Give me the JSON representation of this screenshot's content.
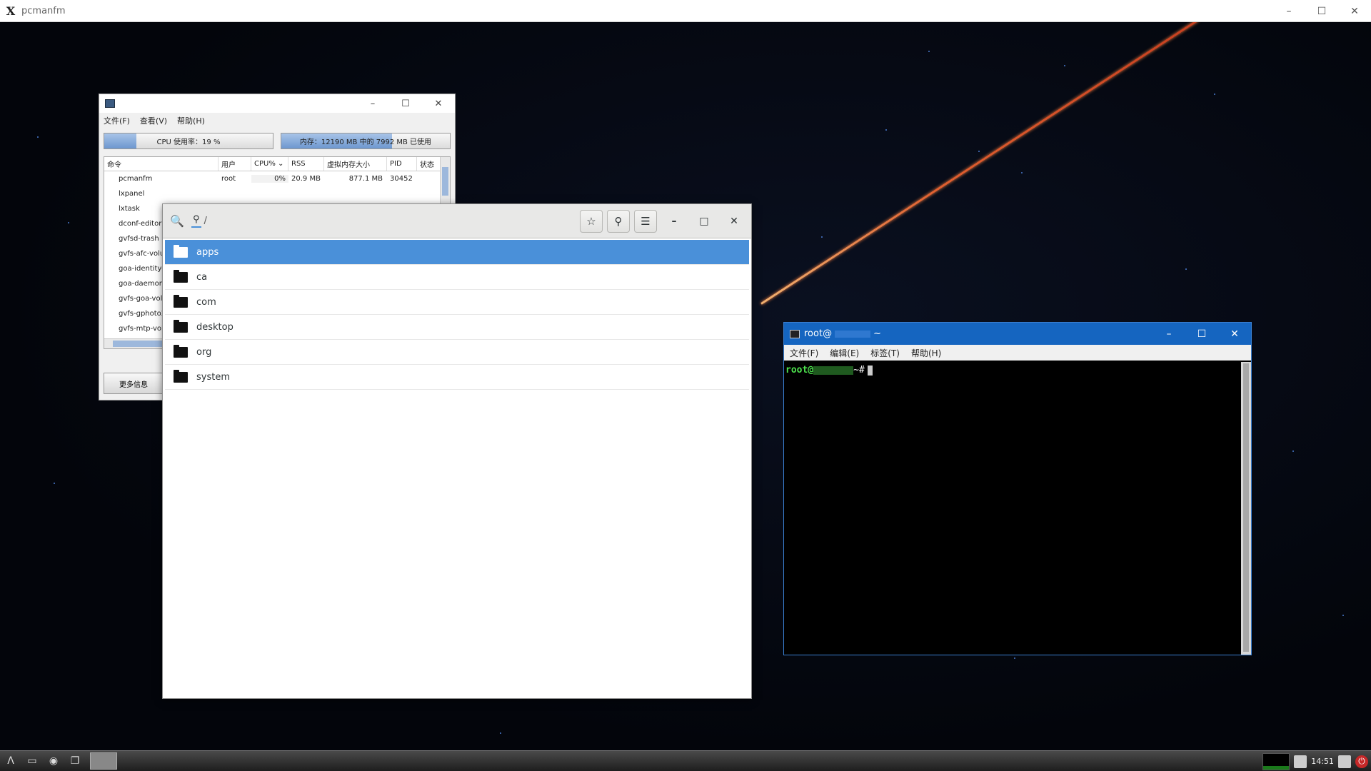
{
  "outer_window": {
    "title": "pcmanfm"
  },
  "lxtask": {
    "menu": [
      "文件(F)",
      "查看(V)",
      "帮助(H)"
    ],
    "cpu_meter": {
      "label": "CPU 使用率：19 %",
      "fraction": 0.19
    },
    "mem_meter": {
      "label": "内存：12190 MB 中的 7992 MB 已使用",
      "fraction": 0.656
    },
    "columns": [
      "命令",
      "用户",
      "CPU%",
      "RSS",
      "虚拟内存大小",
      "PID",
      "状态"
    ],
    "processes": [
      {
        "name": "pcmanfm",
        "user": "root",
        "cpu": "0%",
        "rss": "20.9 MB",
        "vsz": "877.1 MB",
        "pid": "30452"
      },
      {
        "name": "lxpanel"
      },
      {
        "name": "lxtask"
      },
      {
        "name": "dconf-editor"
      },
      {
        "name": "gvfsd-trash"
      },
      {
        "name": "gvfs-afc-volu"
      },
      {
        "name": "goa-identity-s"
      },
      {
        "name": "goa-daemon"
      },
      {
        "name": "gvfs-goa-volu"
      },
      {
        "name": "gvfs-gphoto2"
      },
      {
        "name": "gvfs-mtp-volu"
      }
    ],
    "more_button": "更多信息"
  },
  "file_chooser": {
    "path": "/",
    "items": [
      "apps",
      "ca",
      "com",
      "desktop",
      "org",
      "system"
    ],
    "selected_index": 0
  },
  "terminal": {
    "title": "root@",
    "title_suffix": "~",
    "menu": [
      "文件(F)",
      "编辑(E)",
      "标签(T)",
      "帮助(H)"
    ],
    "prompt_user": "root@",
    "prompt_tail": "~#"
  },
  "taskbar": {
    "clock": "14:51"
  }
}
